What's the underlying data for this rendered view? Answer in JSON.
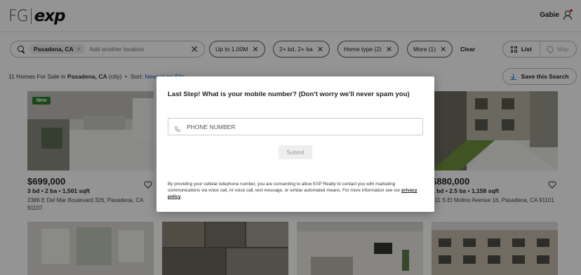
{
  "header": {
    "logo_fg": "FG",
    "logo_exp": "exp",
    "user_name": "Gabie"
  },
  "search": {
    "location_chip": "Pasadena, CA",
    "placeholder": "Add another location"
  },
  "filters": [
    {
      "label": "Up to 1.00M"
    },
    {
      "label": "2+ bd, 2+ ba"
    },
    {
      "label": "Home type (2)"
    },
    {
      "label": "More (1)"
    }
  ],
  "clear_label": "Clear",
  "view": {
    "list_label": "List",
    "map_label": "Map"
  },
  "results": {
    "prefix": "11 Homes For Sale in",
    "city": "Pasadena, CA",
    "suffix": "(city)",
    "sort_label": "Sort:",
    "sort_value": "Newest on Site"
  },
  "save_search_label": "Save this Search",
  "listings": [
    {
      "badge": "New",
      "price": "$699,000",
      "specs": "3 bd • 2 ba • 1,501 sqft",
      "address": "2386 E Del Mar Boulevard 326, Pasadena, CA 91107"
    },
    {
      "price": "$880,000",
      "specs": "2 bd • 2.5 ba • 1,158 sqft",
      "address": "511 S El Molino Avenue 16, Pasadena, CA 91101"
    }
  ],
  "modal": {
    "title": "Last Step! What is your mobile number? (Don't worry we'll never spam you)",
    "phone_placeholder": "PHONE NUMBER",
    "submit_label": "Submit",
    "disclaimer": "By providing your cellular telephone number, you are consenting to allow EXP Realty to contact you with marketing communications via voice call, AI voice call, text message, or similar automated means. For more information see our",
    "privacy_link": "privacy policy",
    "disclaimer_end": "."
  },
  "colors": {
    "accent": "#1e88e5",
    "new_badge": "#2e7d32",
    "overlay": "rgba(0,0,0,0.42)"
  }
}
